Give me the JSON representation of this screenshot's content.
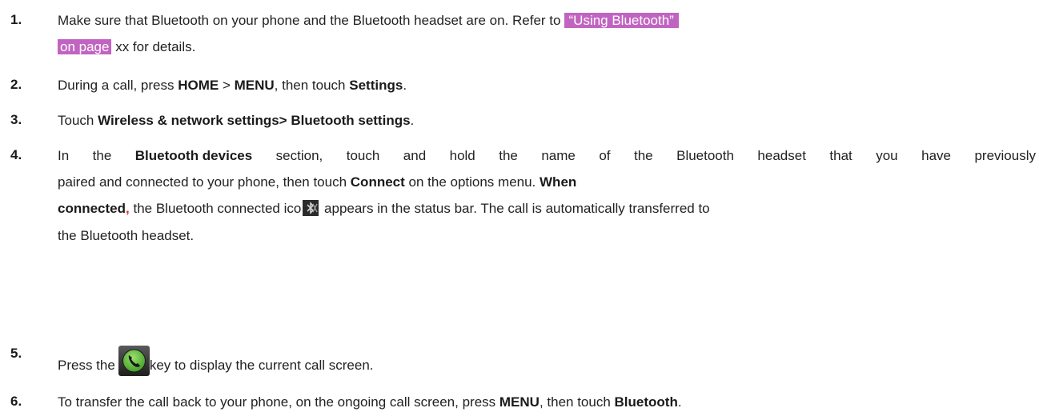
{
  "steps": [
    {
      "number": "1.",
      "line1_before": "Make sure that Bluetooth on your phone and the Bluetooth headset are on. Refer to",
      "link_part1": "“Using  Bluetooth”",
      "link_part2": "on page",
      "line2_after": "xx for details."
    },
    {
      "number": "2.",
      "t1": "During a call, press ",
      "b1": "HOME",
      "t2": " > ",
      "b2": "MENU",
      "t3": ", then touch ",
      "b3": "Settings",
      "t4": "."
    },
    {
      "number": "3.",
      "t1": "Touch ",
      "b1": "Wireless & network settings> Bluetooth settings",
      "t2": "."
    },
    {
      "number": "4.",
      "line1_words": [
        "In",
        "the",
        "Bluetooth devices",
        "section,",
        "touch",
        "and",
        "hold",
        "the",
        "name",
        "of",
        "the",
        "Bluetooth",
        "headset",
        "that",
        "you",
        "have",
        "previously"
      ],
      "line2_t1": "paired and connected to your phone, then touch ",
      "line2_b1": "Connect",
      "line2_t2": " on the options menu. ",
      "line2_b2": "When",
      "line3_b1": "connected",
      "line3_red": ",",
      "line3_t1": " the Bluetooth connected ",
      "line3_t1b": "ico",
      "line3_t2": "  appears in the status bar. The call is automatically transferred to",
      "line4": "the Bluetooth headset."
    },
    {
      "number": "5.",
      "t1": "Press the",
      "t2": "key to display the current call screen."
    },
    {
      "number": "6.",
      "t1": "To transfer the call back to your phone, on the ongoing call screen, press ",
      "b1": "MENU",
      "t2": ", then touch ",
      "b2": "Bluetooth",
      "t3": "."
    }
  ],
  "icons": {
    "bluetooth_connected": "bluetooth-connected-icon",
    "call_key": "call-key-icon"
  },
  "colors": {
    "highlight": "#c164c1",
    "red_comma": "#e0332a",
    "call_key_green": "#5fc43a"
  }
}
